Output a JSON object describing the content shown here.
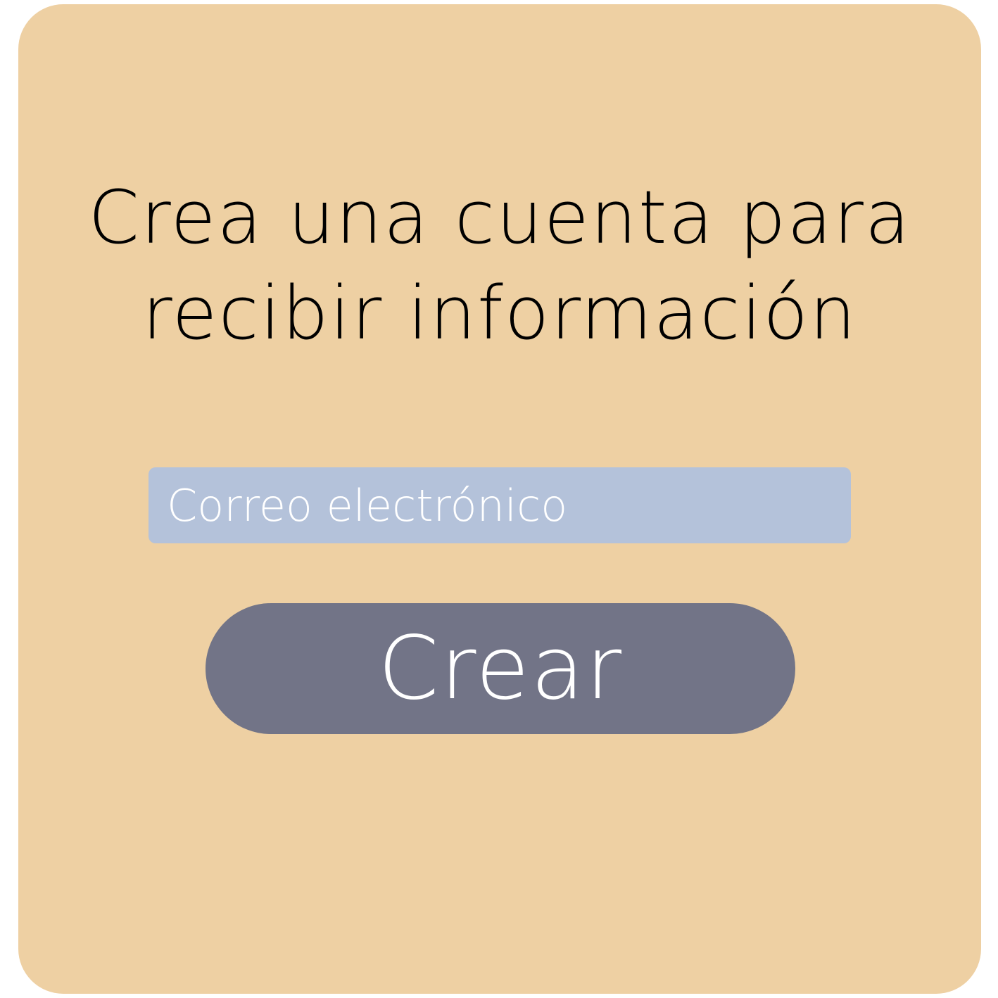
{
  "colors": {
    "page_background": "#ffffff",
    "card_background": "#eed0a3",
    "input_background": "#b4c2da",
    "button_background": "#727487",
    "title_text": "#000000",
    "light_text": "#ffffff"
  },
  "signup": {
    "title_line1": "Crea una cuenta para",
    "title_line2": "recibir información",
    "email_placeholder": "Correo electrónico",
    "submit_label": "Crear"
  }
}
